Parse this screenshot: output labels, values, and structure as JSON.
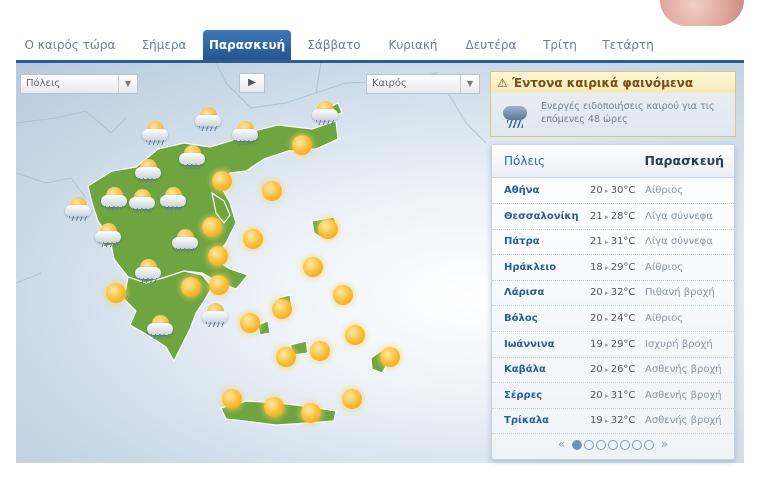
{
  "tabs": [
    {
      "label": "Ο καιρός τώρα",
      "active": false
    },
    {
      "label": "Σήμερα",
      "active": false
    },
    {
      "label": "Παρασκευή",
      "active": true
    },
    {
      "label": "Σάββατο",
      "active": false
    },
    {
      "label": "Κυριακή",
      "active": false
    },
    {
      "label": "Δευτέρα",
      "active": false
    },
    {
      "label": "Τρίτη",
      "active": false
    },
    {
      "label": "Τετάρτη",
      "active": false
    }
  ],
  "map": {
    "cities_select": "Πόλεις",
    "weather_select": "Καιρός",
    "play_icon": "play-icon",
    "weather_icons": [
      "sun-icon",
      "cloud-sun-rain-icon"
    ]
  },
  "alert": {
    "title": "Έντονα καιρικά φαινόμενα",
    "text": "Ενεργές ειδοποιήσεις καιρού για τις επόμενες 48 ώρες",
    "icon": "storm-icon"
  },
  "cities_panel": {
    "header_left": "Πόλεις",
    "header_right": "Παρασκευή",
    "rows": [
      {
        "city": "Αθήνα",
        "min": "20",
        "max": "30°C",
        "desc": "Αίθριος"
      },
      {
        "city": "Θεσσαλονίκη",
        "min": "21",
        "max": "28°C",
        "desc": "Λίγα σύννεφα"
      },
      {
        "city": "Πάτρα",
        "min": "21",
        "max": "31°C",
        "desc": "Λίγα σύννεφα"
      },
      {
        "city": "Ηράκλειο",
        "min": "18",
        "max": "29°C",
        "desc": "Αίθριος"
      },
      {
        "city": "Λάρισα",
        "min": "20",
        "max": "32°C",
        "desc": "Πιθανή βροχή"
      },
      {
        "city": "Βόλος",
        "min": "20",
        "max": "24°C",
        "desc": "Αίθριος"
      },
      {
        "city": "Ιωάννινα",
        "min": "19",
        "max": "29°C",
        "desc": "Ισχυρή βροχή"
      },
      {
        "city": "Καβάλα",
        "min": "20",
        "max": "26°C",
        "desc": "Ασθενής βροχή"
      },
      {
        "city": "Σέρρες",
        "min": "20",
        "max": "31°C",
        "desc": "Ασθενής βροχή"
      },
      {
        "city": "Τρίκαλα",
        "min": "19",
        "max": "32°C",
        "desc": "Ασθενής βροχή"
      }
    ],
    "pager": {
      "prev": "«",
      "next": "»",
      "pages": 7,
      "current": 1
    }
  },
  "colors": {
    "accent": "#2a5d98",
    "land": "#6aa33a",
    "alert_title": "#7a4e12"
  }
}
